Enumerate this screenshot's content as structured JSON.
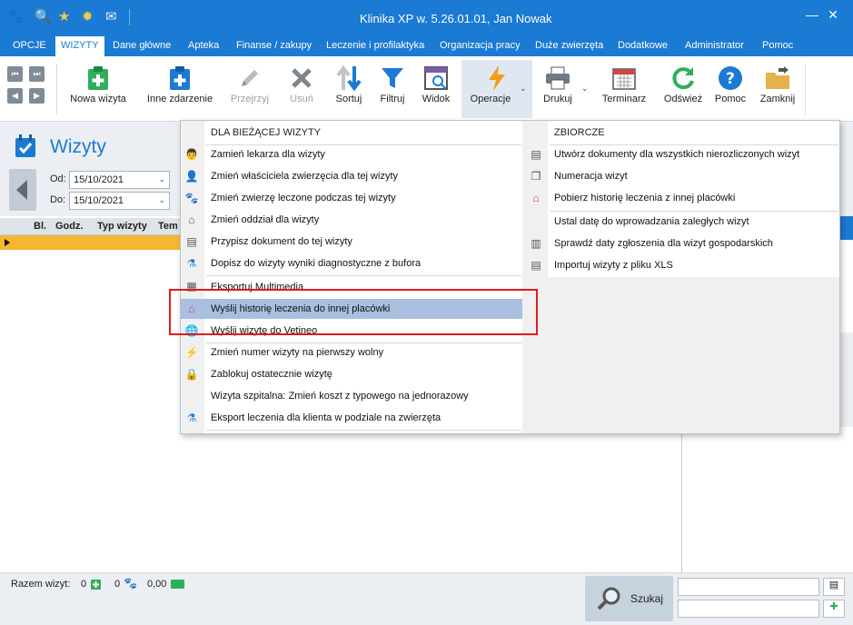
{
  "window": {
    "title": "Klinika XP w. 5.26.01.01, Jan Nowak",
    "min": "—",
    "close": "✕"
  },
  "menu": {
    "items": [
      {
        "label": "OPCJE"
      },
      {
        "label": "WIZYTY"
      },
      {
        "label": "Dane główne"
      },
      {
        "label": "Apteka"
      },
      {
        "label": "Finanse / zakupy"
      },
      {
        "label": "Leczenie i profilaktyka"
      },
      {
        "label": "Organizacja pracy"
      },
      {
        "label": "Duże zwierzęta"
      },
      {
        "label": "Dodatkowe"
      },
      {
        "label": "Administrator"
      },
      {
        "label": "Pomoc"
      }
    ],
    "active": "WIZYTY"
  },
  "toolbar": {
    "new_visit": "Nowa wizyta",
    "other_event": "Inne zdarzenie",
    "review": "Przejrzyj",
    "delete": "Usuń",
    "sort": "Sortuj",
    "filter": "Filtruj",
    "view": "Widok",
    "operations": "Operacje",
    "print": "Drukuj",
    "scheduler": "Terminarz",
    "refresh": "Odśwież",
    "help": "Pomoc",
    "close": "Zamknij"
  },
  "visits": {
    "title": "Wizyty",
    "from_label": "Od:",
    "from_value": "15/10/2021",
    "to_label": "Do:",
    "to_value": "15/10/2021"
  },
  "grid": {
    "columns": [
      "Bl.",
      "Godz.",
      "Typ wizyty",
      "Tem"
    ]
  },
  "dropdown": {
    "current_header": "DLA BIEŻĄCEJ WIZYTY",
    "current_items": [
      {
        "label": "Zamień lekarza dla wizyty",
        "icon": "doctor-icon"
      },
      {
        "label": "Zmień właściciela zwierzęcia dla tej wizyty",
        "icon": "owner-icon"
      },
      {
        "label": "Zmień zwierzę leczone podczas tej wizyty",
        "icon": "paw-icon"
      },
      {
        "label": "Zmień oddział dla wizyty",
        "icon": "home-icon"
      },
      {
        "label": "Przypisz dokument do tej wizyty",
        "icon": "document-gear-icon"
      },
      {
        "label": "Dopisz do wizyty wyniki diagnostyczne z bufora",
        "icon": "flask-icon"
      },
      {
        "label": "Eksportuj Multimedia",
        "icon": "multimedia-icon"
      },
      {
        "label": "Wyślij historię leczenia do innej placówki",
        "icon": "send-home-icon"
      },
      {
        "label": "Wyślij wizytę do Vetineo",
        "icon": "globe-icon"
      },
      {
        "label": "Zmień numer wizyty na pierwszy wolny",
        "icon": "lightning-icon"
      },
      {
        "label": "Zablokuj ostatecznie wizytę",
        "icon": "lock-icon"
      },
      {
        "label": "Wizyta szpitalna: Zmień koszt z typowego na jednorazowy",
        "icon": ""
      },
      {
        "label": "Eksport leczenia dla klienta w podziale na zwierzęta",
        "icon": "flask-icon"
      }
    ],
    "bulk_header": "ZBIORCZE",
    "bulk_items": [
      {
        "label": "Utwórz dokumenty dla wszystkich nierozliczonych wizyt",
        "icon": "document-gear-icon"
      },
      {
        "label": "Numeracja wizyt",
        "icon": "documents-icon"
      },
      {
        "label": "Pobierz historię leczenia z innej placówki",
        "icon": "receive-home-icon"
      },
      {
        "label": "Ustal datę do wprowadzania zaległych wizyt",
        "icon": ""
      },
      {
        "label": "Sprawdź daty zgłoszenia dla wizyt gospodarskich",
        "icon": "calendar-doc-icon"
      },
      {
        "label": "Importuj wizyty z pliku XLS",
        "icon": "document-gear-icon"
      }
    ]
  },
  "status": {
    "total_label": "Razem wizyt:",
    "count_a": "0",
    "count_b": "0",
    "amount": "0,00",
    "search": "Szukaj"
  },
  "colors": {
    "accent": "#1b7ad3",
    "highlight": "#a9bfe0",
    "row_selected": "#f5b731",
    "annotation": "#e21b1b"
  }
}
